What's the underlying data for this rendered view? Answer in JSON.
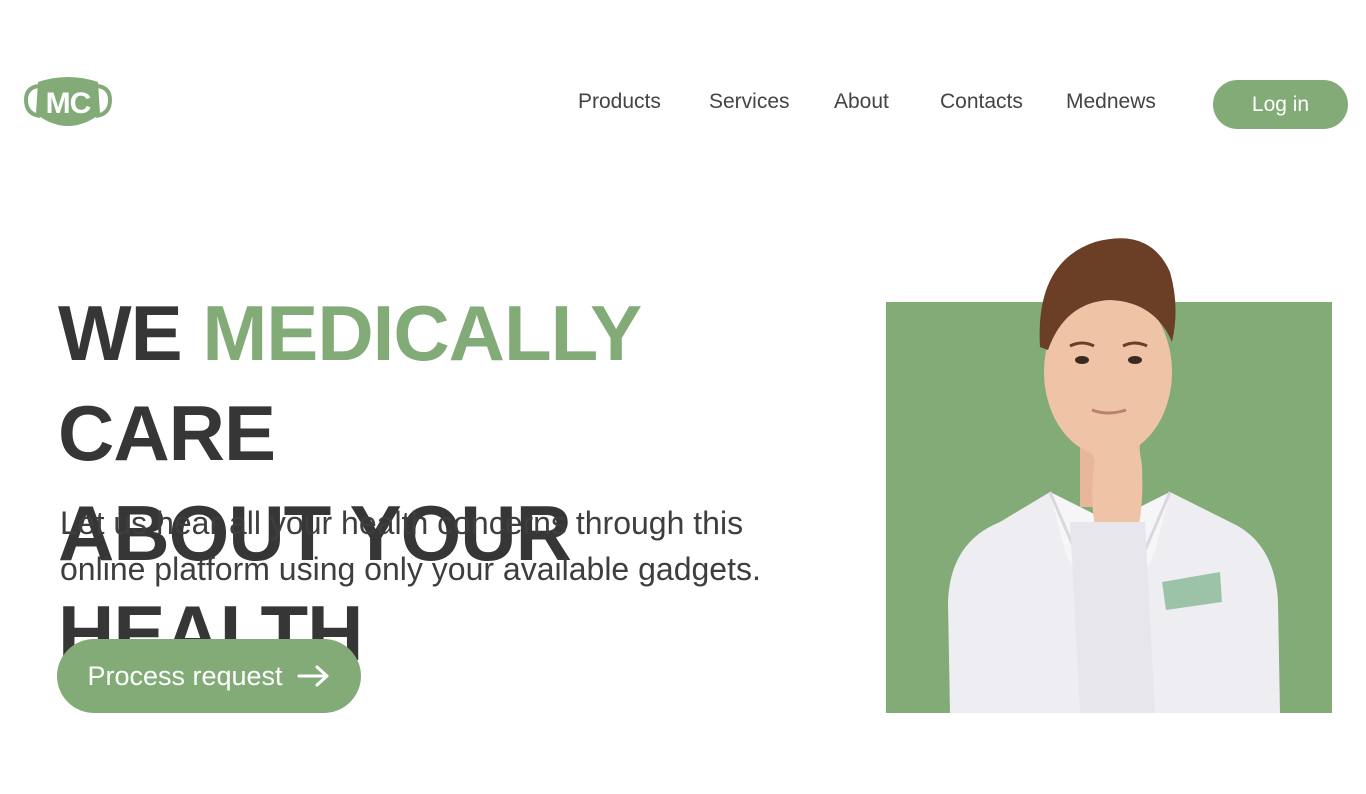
{
  "brand": {
    "logo_text": "MC",
    "accent_color": "#82ab78"
  },
  "nav": {
    "items": [
      {
        "label": "Products"
      },
      {
        "label": "Services"
      },
      {
        "label": "About"
      },
      {
        "label": "Contacts"
      },
      {
        "label": "Mednews"
      }
    ],
    "login_label": "Log in"
  },
  "hero": {
    "headline_part1": "WE",
    "headline_accent": "MEDICALLY",
    "headline_part2": "CARE",
    "headline_line2": "ABOUT YOUR HEALTH",
    "subtext": "Let us hear all your health concerns through this online platform using only your available gadgets.",
    "cta_label": "Process request",
    "cta_icon": "arrow-right-icon",
    "image": "doctor-portrait"
  }
}
